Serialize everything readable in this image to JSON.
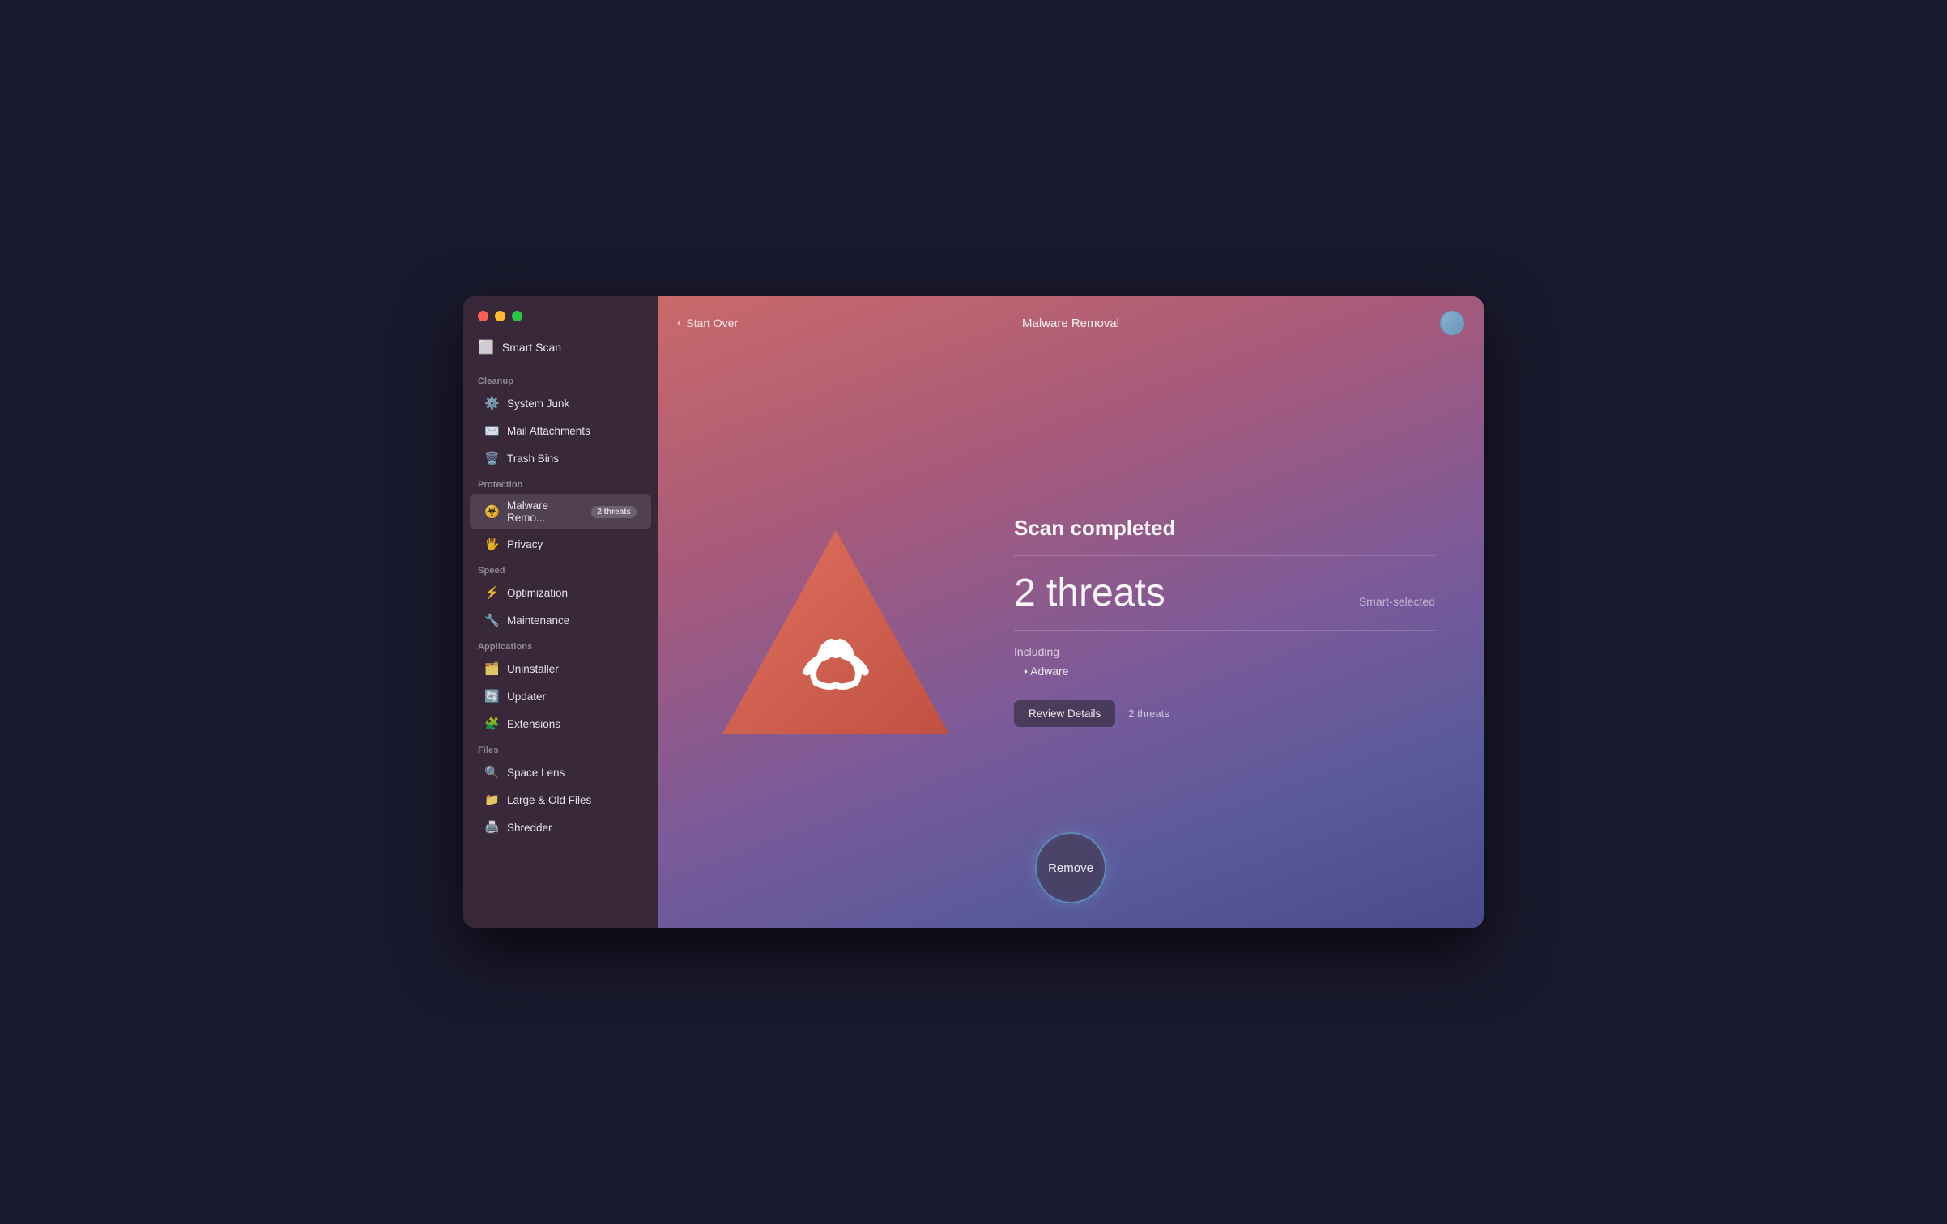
{
  "window": {
    "title": "Malware Removal"
  },
  "traffic_lights": {
    "red": "close",
    "yellow": "minimize",
    "green": "maximize"
  },
  "header": {
    "start_over_label": "Start Over",
    "title": "Malware Removal",
    "avatar_icon": "avatar-icon"
  },
  "sidebar": {
    "smart_scan_label": "Smart Scan",
    "smart_scan_icon": "scan-icon",
    "sections": [
      {
        "label": "Cleanup",
        "items": [
          {
            "id": "system-junk",
            "label": "System Junk",
            "icon": "⚙️",
            "active": false
          },
          {
            "id": "mail-attachments",
            "label": "Mail Attachments",
            "icon": "✉️",
            "active": false
          },
          {
            "id": "trash-bins",
            "label": "Trash Bins",
            "icon": "🗑️",
            "active": false
          }
        ]
      },
      {
        "label": "Protection",
        "items": [
          {
            "id": "malware-removal",
            "label": "Malware Remo...",
            "icon": "☣️",
            "active": true,
            "badge": "2 threats"
          },
          {
            "id": "privacy",
            "label": "Privacy",
            "icon": "🖐️",
            "active": false
          }
        ]
      },
      {
        "label": "Speed",
        "items": [
          {
            "id": "optimization",
            "label": "Optimization",
            "icon": "⚡",
            "active": false
          },
          {
            "id": "maintenance",
            "label": "Maintenance",
            "icon": "🔧",
            "active": false
          }
        ]
      },
      {
        "label": "Applications",
        "items": [
          {
            "id": "uninstaller",
            "label": "Uninstaller",
            "icon": "🗂️",
            "active": false
          },
          {
            "id": "updater",
            "label": "Updater",
            "icon": "🔄",
            "active": false
          },
          {
            "id": "extensions",
            "label": "Extensions",
            "icon": "🧩",
            "active": false
          }
        ]
      },
      {
        "label": "Files",
        "items": [
          {
            "id": "space-lens",
            "label": "Space Lens",
            "icon": "🔍",
            "active": false
          },
          {
            "id": "large-old-files",
            "label": "Large & Old Files",
            "icon": "📁",
            "active": false
          },
          {
            "id": "shredder",
            "label": "Shredder",
            "icon": "🖨️",
            "active": false
          }
        ]
      }
    ]
  },
  "main": {
    "scan_completed_title": "Scan completed",
    "threats_count": "2 threats",
    "smart_selected_label": "Smart-selected",
    "including_label": "Including",
    "items": [
      {
        "name": "Adware"
      }
    ],
    "review_details_label": "Review Details",
    "review_threats_label": "2 threats",
    "remove_label": "Remove"
  }
}
